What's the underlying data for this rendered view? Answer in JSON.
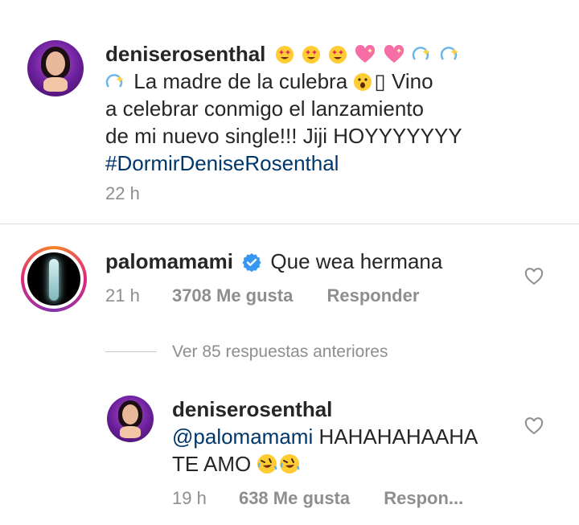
{
  "caption": {
    "username": "deniserosenthal",
    "line1_emojis": [
      "star-struck",
      "star-struck",
      "star-struck",
      "sparkling-heart",
      "sparkling-heart",
      "dizzy",
      "dizzy"
    ],
    "line2_emoji": "dizzy",
    "line2_text": "La madre de la culebra",
    "line2_emoji2": "astonished",
    "line2_box": "▯",
    "line2_tail": "Vino",
    "line3": "a celebrar conmigo el lanzamiento",
    "line4": "de mi nuevo single!!! Jiji HOYYYYYYY",
    "hashtag": "#DormirDeniseRosenthal",
    "time": "22 h"
  },
  "comment1": {
    "username": "palomamami",
    "verified_icon": "verified-badge",
    "text": "Que wea hermana",
    "time": "21 h",
    "likes": "3708 Me gusta",
    "reply": "Responder"
  },
  "view_replies": "Ver 85 respuestas anteriores",
  "reply1": {
    "username": "deniserosenthal",
    "mention": "@palomamami",
    "text1": "HAHAHAHAAHA",
    "text2": "TE AMO",
    "emojis": [
      "rolling-laughing",
      "rolling-laughing"
    ],
    "time": "19 h",
    "likes": "638 Me gusta",
    "reply": "Respon..."
  },
  "colors": {
    "text": "#262626",
    "muted": "#8e8e8e",
    "link": "#00376b",
    "verified": "#3897f0",
    "story_ring": [
      "#f58529",
      "#dd2a7b",
      "#8134af"
    ]
  }
}
